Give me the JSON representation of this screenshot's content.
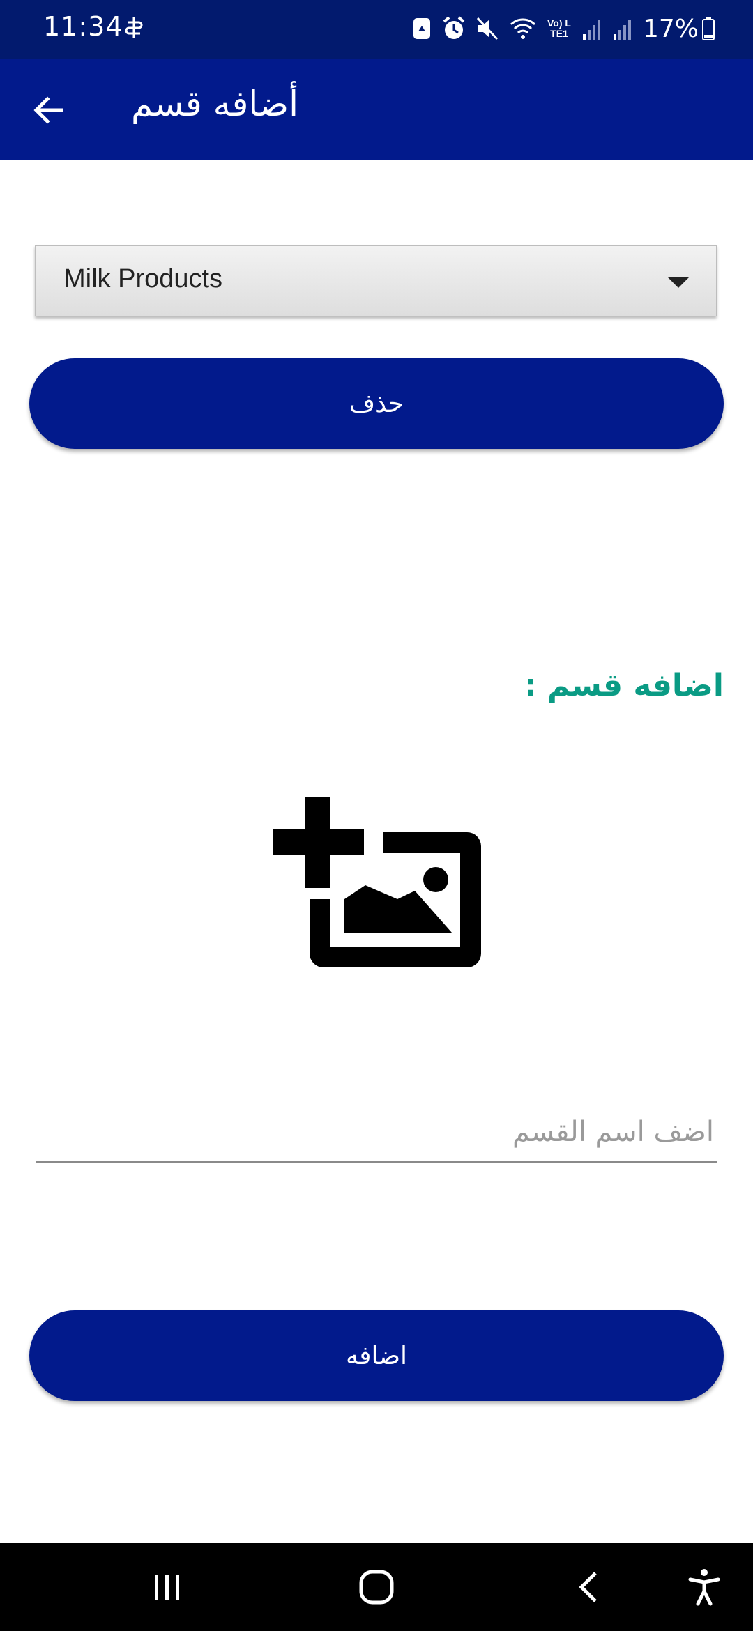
{
  "status_bar": {
    "time": "11:34",
    "battery_percent": "17%",
    "icons": [
      "sim-icon",
      "recycle-icon",
      "alarm-icon",
      "mute-icon",
      "wifi-icon",
      "volte-icon",
      "signal-icon",
      "signal-icon",
      "battery-icon"
    ],
    "volte_label": "Vo) LTE1"
  },
  "app_bar": {
    "title": "أضافه قسم",
    "back_icon": "arrow-left-icon",
    "background_color": "#021a8c"
  },
  "category_dropdown": {
    "selected_value": "Milk Products"
  },
  "delete_button": {
    "label": "حذف"
  },
  "add_section": {
    "label": "اضافه قسم :",
    "label_color": "#0a9b84",
    "image_icon": "add-photo-icon",
    "name_input": {
      "value": "",
      "placeholder": "اضف اسم القسم"
    },
    "add_button_label": "اضافه"
  },
  "nav_bar": {
    "items": [
      "recent-apps-icon",
      "home-icon",
      "back-icon",
      "accessibility-icon"
    ]
  }
}
